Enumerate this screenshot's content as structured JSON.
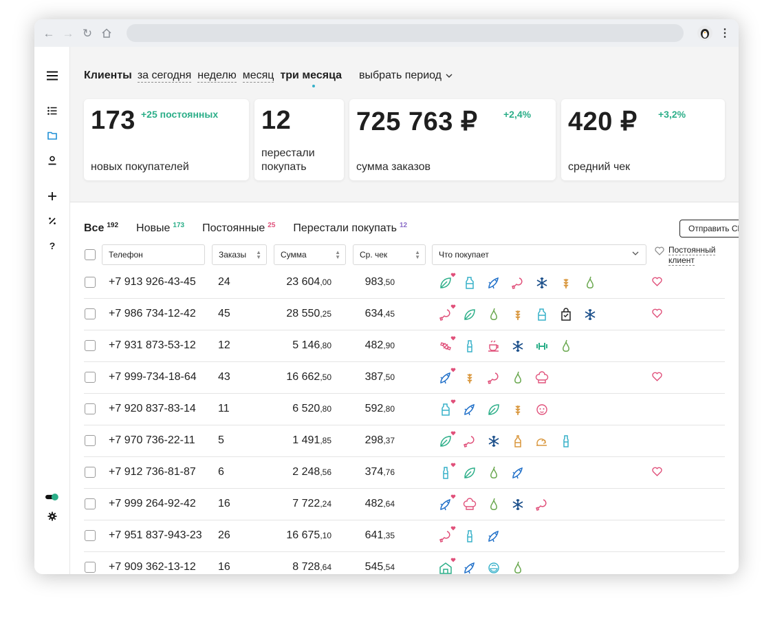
{
  "header": {
    "title": "Клиенты",
    "periods": [
      "за сегодня",
      "неделю",
      "месяц",
      "три месяца"
    ],
    "active_period": "три месяца",
    "select_period": "выбрать период"
  },
  "stats": [
    {
      "value": "173",
      "delta": "+25 постоянных",
      "label": "новых покупателей"
    },
    {
      "value": "12",
      "delta": "",
      "label_line1": "перестали",
      "label_line2": "покупать"
    },
    {
      "value": "725 763 ₽",
      "delta": "+2,4%",
      "label": "сумма заказов"
    },
    {
      "value": "420 ₽",
      "delta": "+3,2%",
      "label": "средний чек"
    }
  ],
  "tabs": [
    {
      "label": "Все",
      "count": "192",
      "count_color": "#1f1f1f"
    },
    {
      "label": "Новые",
      "count": "173",
      "count_color": "#2bae88"
    },
    {
      "label": "Постоянные",
      "count": "25",
      "count_color": "#e0507a"
    },
    {
      "label": "Перестали покупать",
      "count": "12",
      "count_color": "#8a6cc7"
    }
  ],
  "send_sms": "Отправить СМС",
  "columns": {
    "phone": "Телефон",
    "orders": "Заказы",
    "sum": "Сумма",
    "avg": "Ср. чек",
    "buys": "Что покупает",
    "regular_line1": "Постоянный",
    "regular_line2": "клиент"
  },
  "colors": {
    "teal": "#2bae88",
    "blue": "#1f6fc8",
    "pink": "#e0507a",
    "green": "#6aa84f",
    "orange": "#d9963b",
    "cyan": "#36b0c9",
    "dark": "#222222",
    "navy": "#1b4f8a"
  },
  "rows": [
    {
      "phone": "+7 913 926-43-45",
      "orders": "24",
      "sum": "23 604",
      "sum_k": ",00",
      "avg": "983",
      "avg_k": ",50",
      "icons": [
        "leaf-icon",
        "milk-icon",
        "fish-icon",
        "meat-icon",
        "snowflake-icon",
        "wheat-icon",
        "pear-icon"
      ],
      "fav": true
    },
    {
      "phone": "+7 986 734-12-42",
      "orders": "45",
      "sum": "28 550",
      "sum_k": ",25",
      "avg": "634",
      "avg_k": ",45",
      "icons": [
        "meat-icon",
        "leaf-icon",
        "pear-icon",
        "wheat-icon",
        "milk-icon",
        "bag-icon",
        "snowflake-icon"
      ],
      "fav": true
    },
    {
      "phone": "+7 931 873-53-12",
      "orders": "12",
      "sum": "5 146",
      "sum_k": ",80",
      "avg": "482",
      "avg_k": ",90",
      "icons": [
        "candy-icon",
        "bottle-icon",
        "cup-icon",
        "snowflake-icon",
        "dumbbell-icon",
        "pear-icon"
      ],
      "fav": false
    },
    {
      "phone": "+7 999-734-18-64",
      "orders": "43",
      "sum": "16 662",
      "sum_k": ",50",
      "avg": "387",
      "avg_k": ",50",
      "icons": [
        "fish-icon",
        "wheat-icon",
        "meat-icon",
        "pear-icon",
        "chef-hat-icon"
      ],
      "fav": true
    },
    {
      "phone": "+7 920 837-83-14",
      "orders": "11",
      "sum": "6 520",
      "sum_k": ",80",
      "avg": "592",
      "avg_k": ",80",
      "icons": [
        "milk-icon",
        "fish-icon",
        "leaf-icon",
        "wheat-icon",
        "baby-icon"
      ],
      "fav": false
    },
    {
      "phone": "+7 970 736-22-11",
      "orders": "5",
      "sum": "1 491",
      "sum_k": ",85",
      "avg": "298",
      "avg_k": ",37",
      "icons": [
        "leaf-icon",
        "meat-icon",
        "snowflake-icon",
        "sauce-icon",
        "snail-icon",
        "bottle-icon"
      ],
      "fav": false
    },
    {
      "phone": "+7 912 736-81-87",
      "orders": "6",
      "sum": "2 248",
      "sum_k": ",56",
      "avg": "374",
      "avg_k": ",76",
      "icons": [
        "bottle-icon",
        "leaf-icon",
        "pear-icon",
        "fish-icon"
      ],
      "fav": true
    },
    {
      "phone": "+7 999 264-92-42",
      "orders": "16",
      "sum": "7 722",
      "sum_k": ",24",
      "avg": "482",
      "avg_k": ",64",
      "icons": [
        "fish-icon",
        "chef-hat-icon",
        "pear-icon",
        "snowflake-icon",
        "meat-icon"
      ],
      "fav": false
    },
    {
      "phone": "+7 951 837-943-23",
      "orders": "26",
      "sum": "16 675",
      "sum_k": ",10",
      "avg": "641",
      "avg_k": ",35",
      "icons": [
        "meat-icon",
        "bottle-icon",
        "fish-icon"
      ],
      "fav": false
    },
    {
      "phone": "+7 909 362-13-12",
      "orders": "16",
      "sum": "8 728",
      "sum_k": ",64",
      "avg": "545",
      "avg_k": ",54",
      "icons": [
        "house-icon",
        "fish-icon",
        "bowl-icon",
        "pear-icon"
      ],
      "fav": false
    }
  ]
}
